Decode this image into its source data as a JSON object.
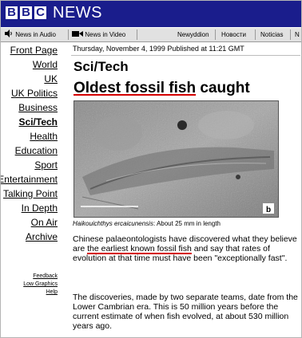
{
  "brand": {
    "letters": [
      "B",
      "B",
      "C"
    ],
    "news": "NEWS"
  },
  "navbar": {
    "news_in_audio": "News in Audio",
    "news_in_video": "News in Video",
    "newyddion": "Newyddion",
    "novosti": "Новости",
    "noticias": "Noticias",
    "last_partial": "N"
  },
  "sidebar": {
    "items": [
      {
        "label": "Front Page"
      },
      {
        "label": "World"
      },
      {
        "label": "UK"
      },
      {
        "label": "UK Politics"
      },
      {
        "label": "Business"
      },
      {
        "label": "Sci/Tech"
      },
      {
        "label": "Health"
      },
      {
        "label": "Education"
      },
      {
        "label": "Sport"
      },
      {
        "label": "Entertainment"
      },
      {
        "label": "Talking Point"
      },
      {
        "label": "In Depth"
      },
      {
        "label": "On Air"
      },
      {
        "label": "Archive"
      }
    ],
    "small_links": [
      {
        "label": "Feedback"
      },
      {
        "label": "Low Graphics"
      },
      {
        "label": "Help"
      }
    ]
  },
  "article": {
    "dateline": "Thursday, November 4, 1999 Published at 11:21 GMT",
    "section": "Sci/Tech",
    "headline_underlined": "Oldest fossil fish",
    "headline_rest": " caught",
    "photo_label": "b",
    "caption_italic": "Haikouichthys ercaicunensis",
    "caption_rest": ": About 25 mm in length",
    "para1_a": "Chinese palaeontologists have discovered what they believe are ",
    "para1_underlined": "the earliest known fossil fish",
    "para1_b": " and say that rates of evolution at that time must have been \"exceptionally fast\".",
    "para2": "The discoveries, made by two separate teams, date from the Lower Cambrian era. This is 50 million years before the current estimate of when fish evolved, at about 530 million years ago."
  },
  "colors": {
    "masthead": "#1a1d8c",
    "navbar_bg": "#e1e1e1",
    "highlight_underline": "#d40000"
  }
}
